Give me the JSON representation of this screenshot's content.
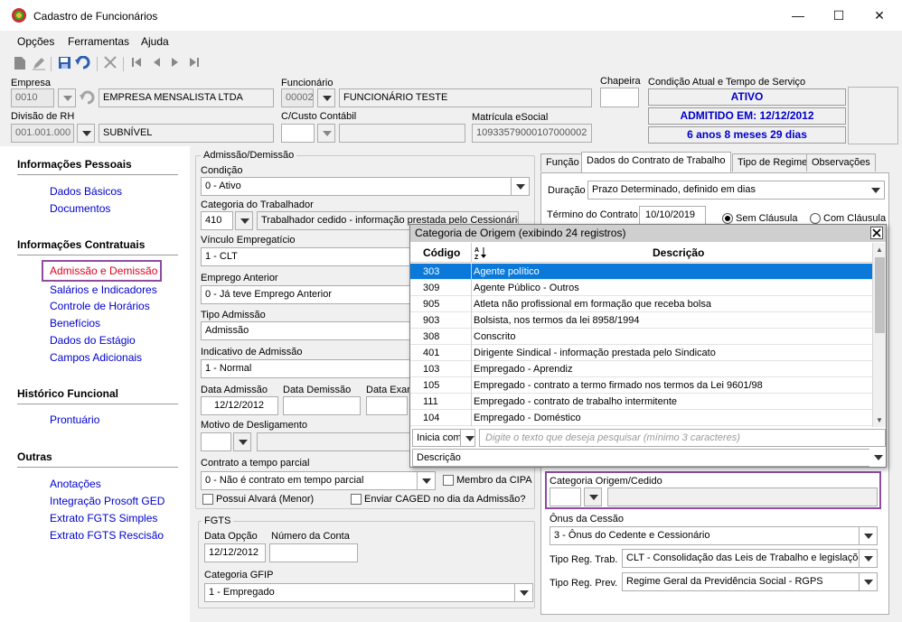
{
  "window": {
    "title": "Cadastro de Funcionários",
    "min": "—",
    "max": "☐",
    "close": "✕"
  },
  "menu": {
    "opcoes": "Opções",
    "ferramentas": "Ferramentas",
    "ajuda": "Ajuda"
  },
  "header": {
    "empresa_label": "Empresa",
    "empresa_code": "0010",
    "empresa_name": "EMPRESA MENSALISTA LTDA",
    "funcionario_label": "Funcionário",
    "funcionario_code": "00002",
    "funcionario_name": "FUNCIONÁRIO TESTE",
    "chapeira_label": "Chapeira",
    "chapeira_value": "",
    "condicao_label": "Condição Atual e Tempo de Serviço",
    "status1": "ATIVO",
    "status2": "ADMITIDO EM: 12/12/2012",
    "status3": "6 anos 8 meses 29 dias",
    "divisao_label": "Divisão de RH",
    "divisao_code": "001.001.000",
    "divisao_name": "SUBNÍVEL",
    "ccusto_label": "C/Custo Contábil",
    "matricula_label": "Matrícula eSocial",
    "matricula_value": "10933579000107000002"
  },
  "sidebar": {
    "sec1": "Informações Pessoais",
    "dados_basicos": "Dados Básicos",
    "documentos": "Documentos",
    "sec2": "Informações Contratuais",
    "admissao": "Admissão e Demissão",
    "salarios": "Salários e Indicadores",
    "controle": "Controle de Horários",
    "beneficios": "Benefícios",
    "estagio": "Dados do Estágio",
    "campos": "Campos Adicionais",
    "sec3": "Histórico Funcional",
    "prontuario": "Prontuário",
    "sec4": "Outras",
    "anotacoes": "Anotações",
    "integracao": "Integração Prosoft GED",
    "fgts_simples": "Extrato FGTS Simples",
    "fgts_rescisao": "Extrato FGTS Rescisão"
  },
  "admissao": {
    "group": "Admissão/Demissão",
    "condicao_label": "Condição",
    "condicao_value": "0 - Ativo",
    "categoria_label": "Categoria do Trabalhador",
    "categoria_code": "410",
    "categoria_desc": "Trabalhador cedido - informação prestada pelo Cessionário",
    "vinculo_label": "Vínculo Empregatício",
    "vinculo_value": "1 - CLT",
    "emprego_label": "Emprego Anterior",
    "emprego_value": "0 - Já teve Emprego Anterior",
    "tipo_label": "Tipo Admissão",
    "tipo_value": "Admissão",
    "indicativo_label": "Indicativo de Admissão",
    "indicativo_value": "1 - Normal",
    "data_adm_label": "Data Admissão",
    "data_adm_value": "12/12/2012",
    "data_dem_label": "Data Demissão",
    "data_exa_label": "Data Exam",
    "motivo_label": "Motivo de Desligamento",
    "contrato_label": "Contrato a tempo parcial",
    "contrato_value": "0 - Não é contrato em tempo parcial",
    "membro_cipa": "Membro da CIPA",
    "alvara": "Possui Alvará (Menor)",
    "caged": "Enviar CAGED no dia da Admissão?"
  },
  "fgts": {
    "group": "FGTS",
    "data_opcao_label": "Data Opção",
    "data_opcao_value": "12/12/2012",
    "conta_label": "Número da Conta",
    "gfip_label": "Categoria GFIP",
    "gfip_value": "1 - Empregado"
  },
  "tabs": {
    "funcao": "Função",
    "contrato": "Dados do Contrato de Trabalho",
    "regime": "Tipo de Regime",
    "obs": "Observações"
  },
  "contrato": {
    "duracao_label": "Duração",
    "duracao_value": "Prazo Determinado, definido em dias",
    "termino_label": "Término do Contrato",
    "termino_value": "10/10/2019",
    "sem_clausula": "Sem Cláusula",
    "com_clausula": "Com Cláusula",
    "cat_origem_label": "Categoria Origem/Cedido",
    "onus_label": "Ônus da Cessão",
    "onus_value": "3 - Ônus do Cedente e Cessionário",
    "reg_trab_label": "Tipo Reg. Trab.",
    "reg_trab_value": "CLT - Consolidação das Leis de Trabalho e legislações t",
    "reg_prev_label": "Tipo Reg. Prev.",
    "reg_prev_value": "Regime Geral da Previdência Social - RGPS"
  },
  "popup": {
    "title": "Categoria de Origem (exibindo 24 registros)",
    "col_code": "Código",
    "col_desc": "Descrição",
    "sort_icon": "A↓Z",
    "rows": [
      {
        "code": "303",
        "desc": "Agente político"
      },
      {
        "code": "309",
        "desc": "Agente Público - Outros"
      },
      {
        "code": "905",
        "desc": "Atleta não profissional em formação que receba bolsa"
      },
      {
        "code": "903",
        "desc": "Bolsista, nos termos da lei 8958/1994"
      },
      {
        "code": "308",
        "desc": "Conscrito"
      },
      {
        "code": "401",
        "desc": "Dirigente Sindical - informação prestada pelo Sindicato"
      },
      {
        "code": "103",
        "desc": "Empregado - Aprendiz"
      },
      {
        "code": "105",
        "desc": "Empregado - contrato a termo firmado nos termos da Lei 9601/98"
      },
      {
        "code": "111",
        "desc": "Empregado - contrato de trabalho intermitente"
      },
      {
        "code": "104",
        "desc": "Empregado - Doméstico"
      }
    ],
    "filter_mode": "Inicia com",
    "search_placeholder": "Digite o texto que deseja pesquisar (mínimo 3 caracteres)",
    "field": "Descrição"
  }
}
